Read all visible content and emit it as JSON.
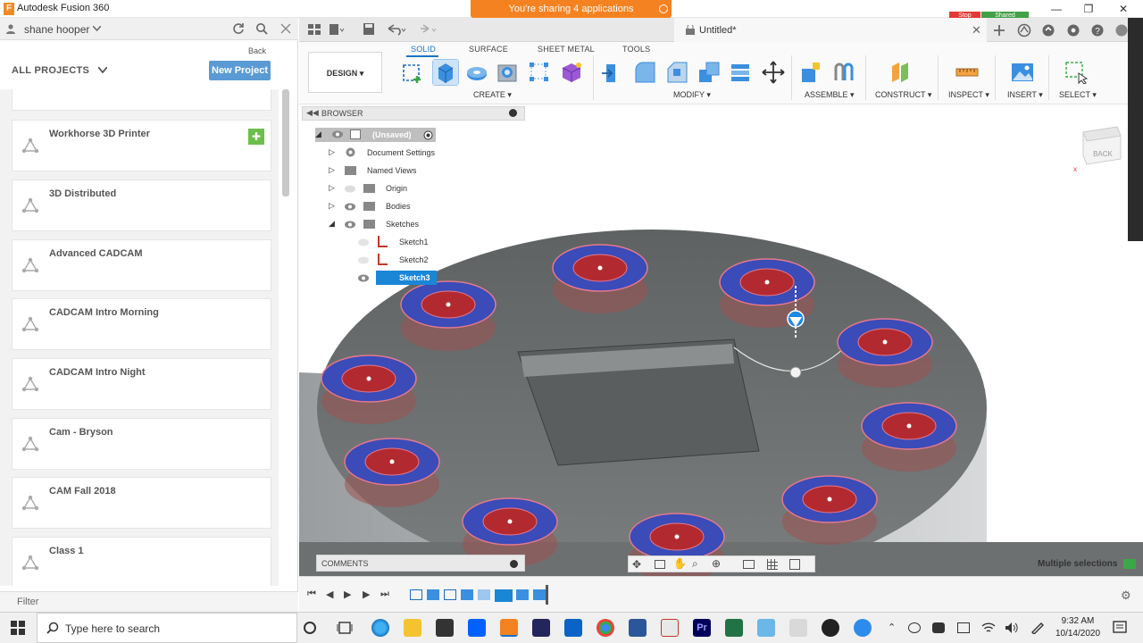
{
  "app": {
    "title": "Autodesk Fusion 360",
    "sharing_banner": "You're sharing 4 applications",
    "stop_label": "Stop",
    "shared_label": "Shared"
  },
  "data_panel": {
    "user": "shane hooper",
    "back_label": "Back",
    "all_projects_label": "ALL PROJECTS",
    "new_project_label": "New Project",
    "projects": [
      {
        "name": "Workhorse 3D Printer"
      },
      {
        "name": "3D Distributed"
      },
      {
        "name": "Advanced CADCAM"
      },
      {
        "name": "CADCAM Intro Morning"
      },
      {
        "name": "CADCAM Intro Night"
      },
      {
        "name": "Cam - Bryson"
      },
      {
        "name": "CAM Fall 2018"
      },
      {
        "name": "Class 1"
      }
    ],
    "filter_label": "Filter"
  },
  "document": {
    "tab_title": "Untitled*"
  },
  "ribbon": {
    "workspace": "DESIGN",
    "tabs": [
      "SOLID",
      "SURFACE",
      "SHEET METAL",
      "TOOLS"
    ],
    "active_tab": "SOLID",
    "groups": [
      "CREATE",
      "MODIFY",
      "ASSEMBLE",
      "CONSTRUCT",
      "INSPECT",
      "INSERT",
      "SELECT"
    ]
  },
  "browser": {
    "title": "BROWSER",
    "root": "(Unsaved)",
    "nodes": [
      "Document Settings",
      "Named Views",
      "Origin",
      "Bodies",
      "Sketches"
    ],
    "sketches": [
      "Sketch1",
      "Sketch2",
      "Sketch3"
    ],
    "selected": "Sketch3"
  },
  "viewcube": {
    "face": "BACK"
  },
  "comments": {
    "title": "COMMENTS"
  },
  "status": {
    "selection": "Multiple selections"
  },
  "taskbar": {
    "search_placeholder": "Type here to search",
    "time": "9:32 AM",
    "date": "10/14/2020"
  },
  "colors": {
    "accent_blue": "#1a73c4",
    "share_orange": "#f58220",
    "model_gray": "#6b6e6f",
    "hole_blue": "#3b4bb8",
    "hole_red": "#b22a30"
  }
}
